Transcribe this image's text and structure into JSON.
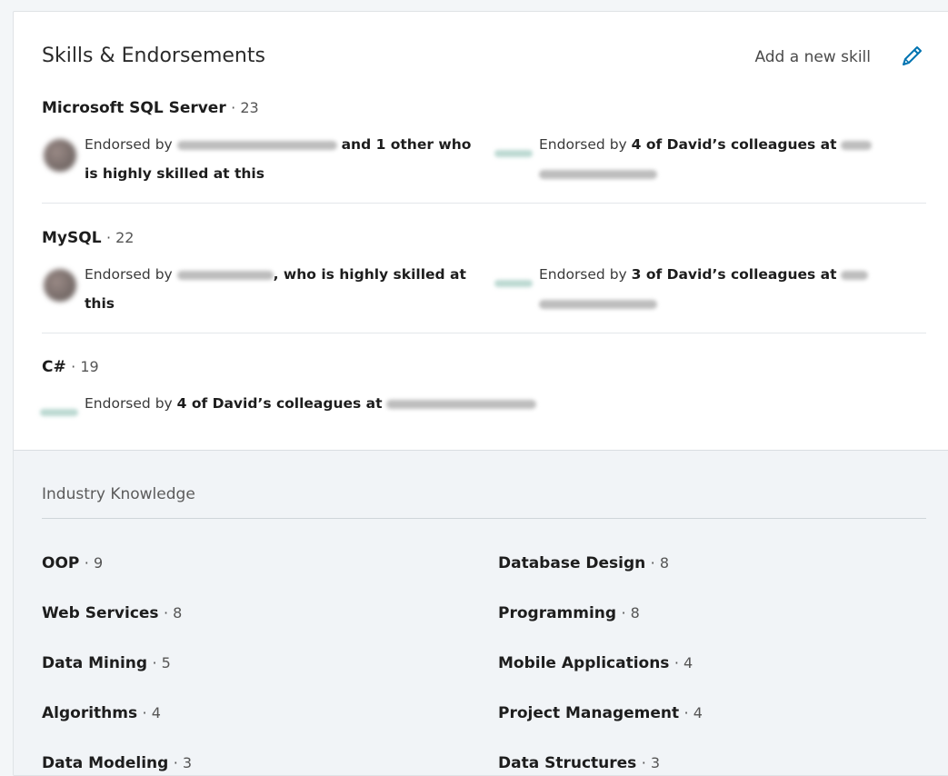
{
  "section": {
    "title": "Skills & Endorsements",
    "add_skill_label": "Add a new skill",
    "accent_color": "#0073b1"
  },
  "top_skills": [
    {
      "name": "Microsoft SQL Server",
      "count": "23",
      "endorsements": [
        {
          "icon": "endorser-avatar",
          "line1_prefix": "Endorsed by",
          "line1_suffix": "and 1 other who",
          "line2": "is highly skilled at this"
        },
        {
          "icon": "company-logo",
          "line1_prefix": "Endorsed by",
          "line1_bold": "4 of David’s colleagues at"
        }
      ]
    },
    {
      "name": "MySQL",
      "count": "22",
      "endorsements": [
        {
          "icon": "endorser-avatar",
          "line1_prefix": "Endorsed by",
          "line1_suffix": ", who is highly skilled at",
          "line2": "this"
        },
        {
          "icon": "company-logo",
          "line1_prefix": "Endorsed by",
          "line1_bold": "3 of David’s colleagues at"
        }
      ]
    },
    {
      "name": "C#",
      "count": "19",
      "endorsements": [
        {
          "icon": "company-logo",
          "line1_prefix": "Endorsed by",
          "line1_bold": "4 of David’s colleagues at"
        }
      ]
    }
  ],
  "industry_knowledge": {
    "heading": "Industry Knowledge",
    "items": [
      {
        "name": "OOP",
        "count": "9"
      },
      {
        "name": "Database Design",
        "count": "8"
      },
      {
        "name": "Web Services",
        "count": "8"
      },
      {
        "name": "Programming",
        "count": "8"
      },
      {
        "name": "Data Mining",
        "count": "5"
      },
      {
        "name": "Mobile Applications",
        "count": "4"
      },
      {
        "name": "Algorithms",
        "count": "4"
      },
      {
        "name": "Project Management",
        "count": "4"
      },
      {
        "name": "Data Modeling",
        "count": "3"
      },
      {
        "name": "Data Structures",
        "count": "3"
      }
    ]
  }
}
